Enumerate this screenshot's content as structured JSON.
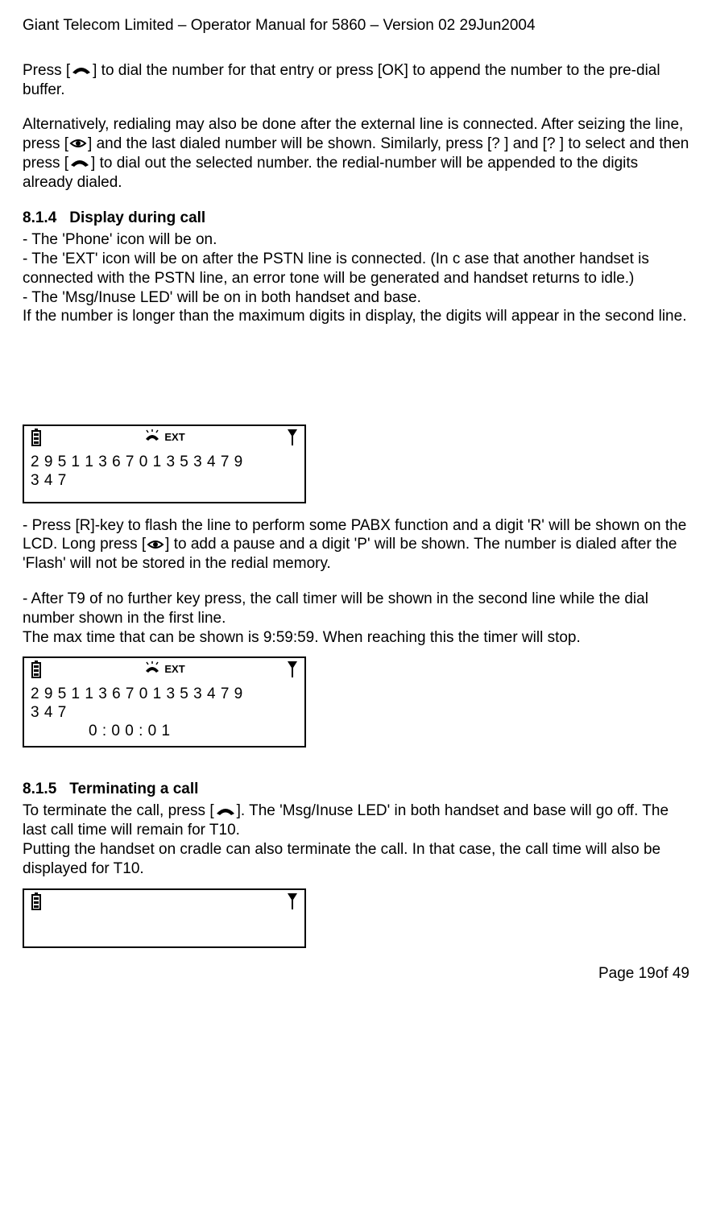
{
  "header": "Giant Telecom Limited – Operator Manual for 5860 – Version 02 29Jun2004",
  "para1a": "Press [",
  "para1b": "] to dial the number for that entry or press [OK] to append the number to the pre-dial buffer.",
  "para2a": "Alternatively, redialing may also be done after the external line is connected. After seizing the line, press [",
  "para2b": "] and the last dialed number will be shown. Similarly, press [? ] and [? ] to select and then press [",
  "para2c": "] to dial out the selected number. the redial-number will be appended to the digits already dialed.",
  "section_814_num": "8.1.4",
  "section_814_title": "Display during call",
  "s814_l1": "- The 'Phone' icon will be on.",
  "s814_l2": "- The 'EXT' icon will be on after the PSTN line is connected. (In c ase that another handset is connected with the PSTN line, an error tone will be generated and handset returns to idle.)",
  "s814_l3": "- The 'Msg/Inuse LED' will be on in both handset and base.",
  "s814_l4": "If the number is longer than the maximum digits in display, the digits will appear in the second line.",
  "lcd1": {
    "ext": "EXT",
    "line1": "2 9 5 1 1 3 6 7 0 1 3 5 3 4 7 9",
    "line2": "3 4 7"
  },
  "para3a": "- Press [R]-key to flash the line to perform some PABX function and a digit 'R' will be shown on the LCD.  Long press [",
  "para3b": "] to add a pause and a digit 'P' will be shown. The number is dialed after the 'Flash' will not be stored in the redial memory.",
  "para4": "- After T9 of no further key press, the call timer will be shown in the second line while the dial number shown in the first line.",
  "para5": "The max time that can be shown is 9:59:59. When reaching this the timer will stop.",
  "lcd2": {
    "ext": "EXT",
    "line1": "2 9 5 1 1 3 6 7 0 1 3 5 3 4 7 9",
    "line2": "3 4 7",
    "line3": "0  :  0 0  :  0 1"
  },
  "section_815_num": "8.1.5",
  "section_815_title": "Terminating a call",
  "s815a": "To terminate the call, press [",
  "s815b": "].  The 'Msg/Inuse LED' in both handset and base will go off.  The last call time will remain for T10.",
  "s815c": "Putting the handset on cradle can also terminate the call. In that case, the call time will also be displayed for T10.",
  "footer": "Page 19of 49"
}
